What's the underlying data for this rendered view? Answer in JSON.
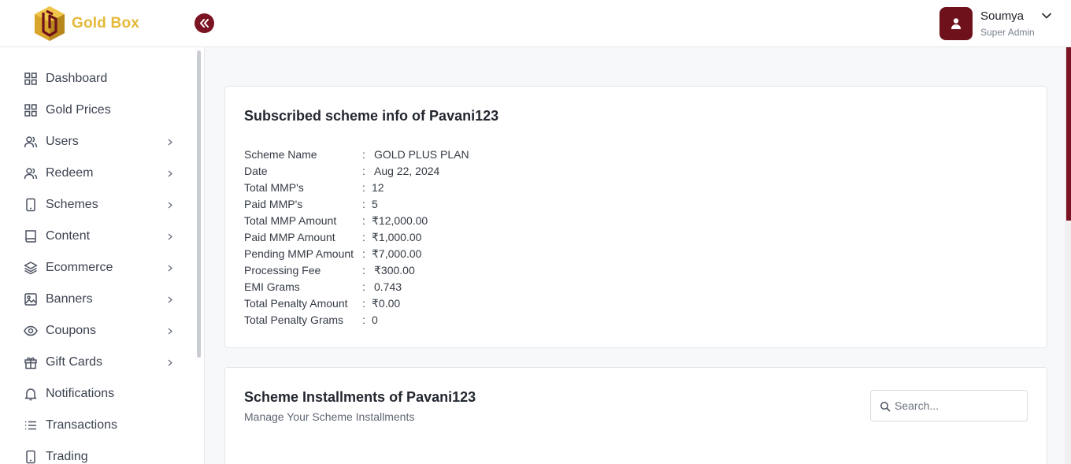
{
  "brand": {
    "name": "Gold Box",
    "accent": "#7a1422",
    "gold": "#e4b93a"
  },
  "header": {
    "collapse_icon": "double-chevron-left-icon",
    "user": {
      "name": "Soumya",
      "role": "Super Admin",
      "avatar_icon": "user-icon",
      "menu_icon": "chevron-down-icon"
    }
  },
  "sidebar": {
    "items": [
      {
        "label": "Dashboard",
        "icon": "grid-icon",
        "has_children": false
      },
      {
        "label": "Gold Prices",
        "icon": "grid-icon",
        "has_children": false
      },
      {
        "label": "Users",
        "icon": "users-icon",
        "has_children": true
      },
      {
        "label": "Redeem",
        "icon": "users-icon",
        "has_children": true
      },
      {
        "label": "Schemes",
        "icon": "phone-icon",
        "has_children": true
      },
      {
        "label": "Content",
        "icon": "book-icon",
        "has_children": true
      },
      {
        "label": "Ecommerce",
        "icon": "layers-icon",
        "has_children": true
      },
      {
        "label": "Banners",
        "icon": "image-icon",
        "has_children": true
      },
      {
        "label": "Coupons",
        "icon": "eye-icon",
        "has_children": true
      },
      {
        "label": "Gift Cards",
        "icon": "gift-icon",
        "has_children": true
      },
      {
        "label": "Notifications",
        "icon": "bell-icon",
        "has_children": false
      },
      {
        "label": "Transactions",
        "icon": "list-icon",
        "has_children": false
      },
      {
        "label": "Trading",
        "icon": "phone-icon",
        "has_children": false
      }
    ]
  },
  "scheme_info": {
    "title": "Subscribed scheme info of Pavani123",
    "rows": [
      {
        "label": "Scheme Name",
        "value": "GOLD PLUS PLAN"
      },
      {
        "label": "Date",
        "value": "Aug 22, 2024"
      },
      {
        "label": "Total MMP's",
        "value": "12"
      },
      {
        "label": "Paid MMP's",
        "value": "5"
      },
      {
        "label": "Total MMP Amount",
        "value": "₹12,000.00"
      },
      {
        "label": "Paid MMP Amount",
        "value": "₹1,000.00"
      },
      {
        "label": "Pending MMP Amount",
        "value": "₹7,000.00"
      },
      {
        "label": "Processing Fee",
        "value": "₹300.00"
      },
      {
        "label": "EMI Grams",
        "value": "0.743"
      },
      {
        "label": "Total Penalty Amount",
        "value": "₹0.00"
      },
      {
        "label": "Total Penalty Grams",
        "value": "0"
      }
    ],
    "separator": ":"
  },
  "installments": {
    "title": "Scheme Installments of Pavani123",
    "subtitle": "Manage Your Scheme Installments",
    "search": {
      "placeholder": "Search...",
      "value": "",
      "icon": "search-icon"
    }
  }
}
